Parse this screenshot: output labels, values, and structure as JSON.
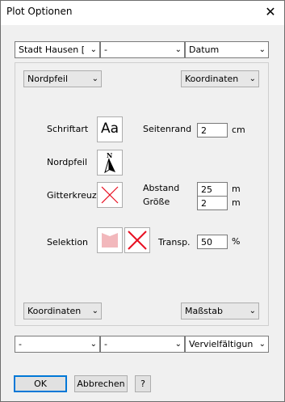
{
  "window": {
    "title": "Plot Optionen",
    "close_icon": "close-icon"
  },
  "top_row": {
    "combo1": "Stadt Hausen [..",
    "combo2": "-",
    "combo3": "Datum"
  },
  "panel": {
    "top_left_combo": "Nordpfeil",
    "top_right_combo": "Koordinaten",
    "labels": {
      "schriftart": "Schriftart",
      "nordpfeil": "Nordpfeil",
      "gitterkreuze": "Gitterkreuze",
      "selektion": "Selektion",
      "seitenrand": "Seitenrand",
      "abstand": "Abstand",
      "groesse": "Größe",
      "transp": "Transp."
    },
    "font_button_text": "Aa",
    "north_button_letter": "N",
    "fields": {
      "seitenrand": "2",
      "abstand": "25",
      "groesse": "2",
      "transp": "50"
    },
    "units": {
      "seitenrand": "cm",
      "abstand": "m",
      "groesse": "m",
      "transp": "%"
    },
    "bottom_left_combo": "Koordinaten",
    "bottom_right_combo": "Maßstab"
  },
  "bottom_row": {
    "combo1": "-",
    "combo2": "-",
    "combo3": "Vervielfältigung n"
  },
  "buttons": {
    "ok": "OK",
    "cancel": "Abbrechen",
    "help": "?"
  },
  "colors": {
    "selection_fill": "#f2b8bc",
    "cross": "#e81123",
    "accent": "#0078d7"
  }
}
